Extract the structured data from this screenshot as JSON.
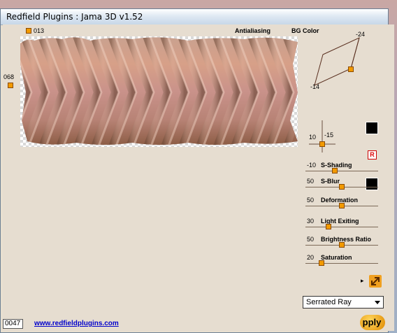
{
  "window": {
    "title": "Redfield Plugins : Jama 3D  v1.52"
  },
  "top_value": "013",
  "left_value": "068",
  "header": {
    "antialiasing": "Antialiasing",
    "bg_color": "BG Color"
  },
  "light_widget": {
    "label_top": "-24",
    "label_bottom": "-14"
  },
  "position_widget": {
    "x": "10",
    "y": "-15"
  },
  "r_button": "R",
  "sliders": [
    {
      "value": "-10",
      "label": "S-Shading",
      "level": 0.4
    },
    {
      "value": "50",
      "label": "S-Blur",
      "level": 0.5
    },
    {
      "value": "50",
      "label": "Deformation",
      "level": 0.5
    },
    {
      "value": "30",
      "label": "Light Exiting",
      "level": 0.3
    },
    {
      "value": "50",
      "label": "Brightness Ratio",
      "level": 0.5
    },
    {
      "value": "20",
      "label": "Saturation",
      "level": 0.2
    }
  ],
  "dropdown": {
    "selected": "Serrated Ray"
  },
  "counter": "0047",
  "link": "www.redfieldplugins.com",
  "apply_label": "pply",
  "colors": {
    "accent": "#f29a00",
    "panel": "#e6ddd0",
    "link": "#0000cc"
  }
}
